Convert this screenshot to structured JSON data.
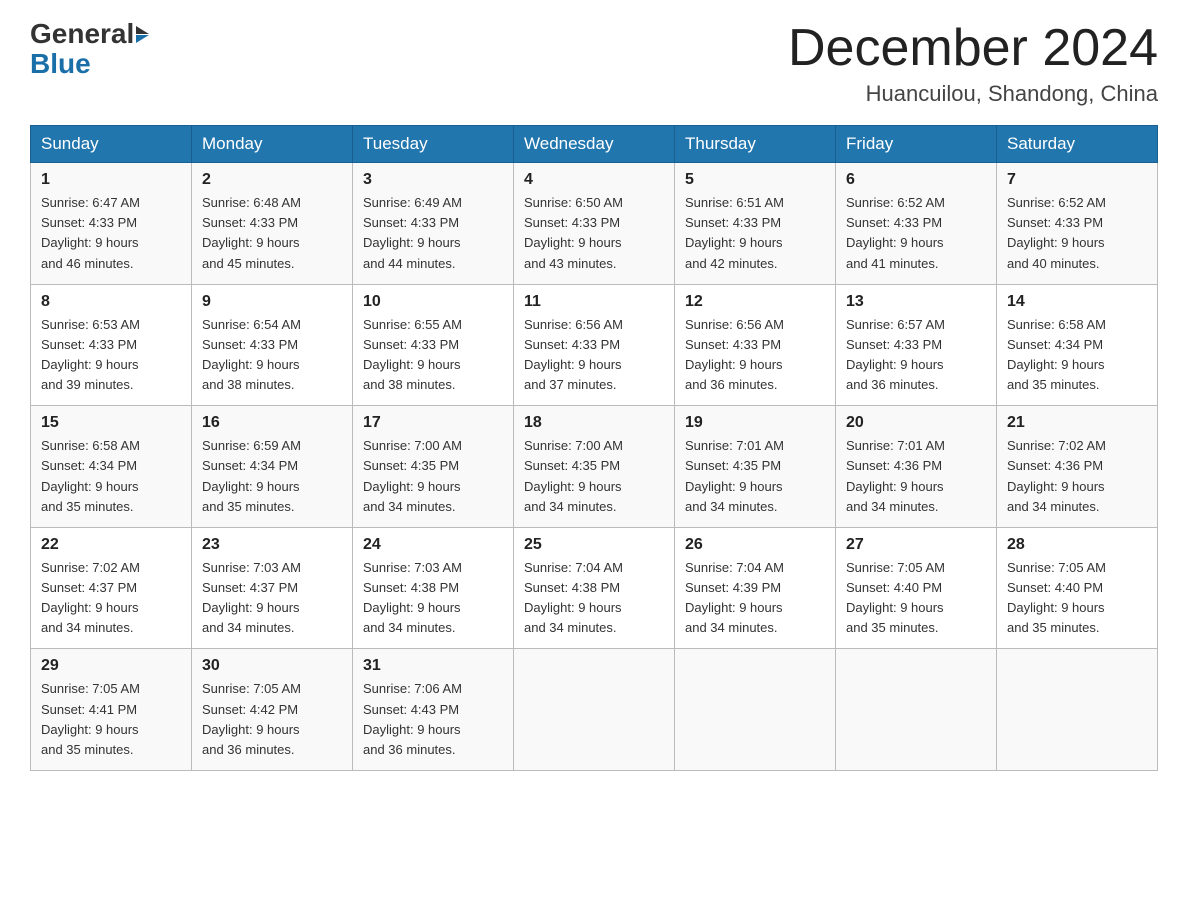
{
  "header": {
    "logo_general": "General",
    "logo_blue": "Blue",
    "month_title": "December 2024",
    "location": "Huancuilou, Shandong, China"
  },
  "days_of_week": [
    "Sunday",
    "Monday",
    "Tuesday",
    "Wednesday",
    "Thursday",
    "Friday",
    "Saturday"
  ],
  "weeks": [
    [
      {
        "day": "1",
        "sunrise": "6:47 AM",
        "sunset": "4:33 PM",
        "daylight": "9 hours and 46 minutes."
      },
      {
        "day": "2",
        "sunrise": "6:48 AM",
        "sunset": "4:33 PM",
        "daylight": "9 hours and 45 minutes."
      },
      {
        "day": "3",
        "sunrise": "6:49 AM",
        "sunset": "4:33 PM",
        "daylight": "9 hours and 44 minutes."
      },
      {
        "day": "4",
        "sunrise": "6:50 AM",
        "sunset": "4:33 PM",
        "daylight": "9 hours and 43 minutes."
      },
      {
        "day": "5",
        "sunrise": "6:51 AM",
        "sunset": "4:33 PM",
        "daylight": "9 hours and 42 minutes."
      },
      {
        "day": "6",
        "sunrise": "6:52 AM",
        "sunset": "4:33 PM",
        "daylight": "9 hours and 41 minutes."
      },
      {
        "day": "7",
        "sunrise": "6:52 AM",
        "sunset": "4:33 PM",
        "daylight": "9 hours and 40 minutes."
      }
    ],
    [
      {
        "day": "8",
        "sunrise": "6:53 AM",
        "sunset": "4:33 PM",
        "daylight": "9 hours and 39 minutes."
      },
      {
        "day": "9",
        "sunrise": "6:54 AM",
        "sunset": "4:33 PM",
        "daylight": "9 hours and 38 minutes."
      },
      {
        "day": "10",
        "sunrise": "6:55 AM",
        "sunset": "4:33 PM",
        "daylight": "9 hours and 38 minutes."
      },
      {
        "day": "11",
        "sunrise": "6:56 AM",
        "sunset": "4:33 PM",
        "daylight": "9 hours and 37 minutes."
      },
      {
        "day": "12",
        "sunrise": "6:56 AM",
        "sunset": "4:33 PM",
        "daylight": "9 hours and 36 minutes."
      },
      {
        "day": "13",
        "sunrise": "6:57 AM",
        "sunset": "4:33 PM",
        "daylight": "9 hours and 36 minutes."
      },
      {
        "day": "14",
        "sunrise": "6:58 AM",
        "sunset": "4:34 PM",
        "daylight": "9 hours and 35 minutes."
      }
    ],
    [
      {
        "day": "15",
        "sunrise": "6:58 AM",
        "sunset": "4:34 PM",
        "daylight": "9 hours and 35 minutes."
      },
      {
        "day": "16",
        "sunrise": "6:59 AM",
        "sunset": "4:34 PM",
        "daylight": "9 hours and 35 minutes."
      },
      {
        "day": "17",
        "sunrise": "7:00 AM",
        "sunset": "4:35 PM",
        "daylight": "9 hours and 34 minutes."
      },
      {
        "day": "18",
        "sunrise": "7:00 AM",
        "sunset": "4:35 PM",
        "daylight": "9 hours and 34 minutes."
      },
      {
        "day": "19",
        "sunrise": "7:01 AM",
        "sunset": "4:35 PM",
        "daylight": "9 hours and 34 minutes."
      },
      {
        "day": "20",
        "sunrise": "7:01 AM",
        "sunset": "4:36 PM",
        "daylight": "9 hours and 34 minutes."
      },
      {
        "day": "21",
        "sunrise": "7:02 AM",
        "sunset": "4:36 PM",
        "daylight": "9 hours and 34 minutes."
      }
    ],
    [
      {
        "day": "22",
        "sunrise": "7:02 AM",
        "sunset": "4:37 PM",
        "daylight": "9 hours and 34 minutes."
      },
      {
        "day": "23",
        "sunrise": "7:03 AM",
        "sunset": "4:37 PM",
        "daylight": "9 hours and 34 minutes."
      },
      {
        "day": "24",
        "sunrise": "7:03 AM",
        "sunset": "4:38 PM",
        "daylight": "9 hours and 34 minutes."
      },
      {
        "day": "25",
        "sunrise": "7:04 AM",
        "sunset": "4:38 PM",
        "daylight": "9 hours and 34 minutes."
      },
      {
        "day": "26",
        "sunrise": "7:04 AM",
        "sunset": "4:39 PM",
        "daylight": "9 hours and 34 minutes."
      },
      {
        "day": "27",
        "sunrise": "7:05 AM",
        "sunset": "4:40 PM",
        "daylight": "9 hours and 35 minutes."
      },
      {
        "day": "28",
        "sunrise": "7:05 AM",
        "sunset": "4:40 PM",
        "daylight": "9 hours and 35 minutes."
      }
    ],
    [
      {
        "day": "29",
        "sunrise": "7:05 AM",
        "sunset": "4:41 PM",
        "daylight": "9 hours and 35 minutes."
      },
      {
        "day": "30",
        "sunrise": "7:05 AM",
        "sunset": "4:42 PM",
        "daylight": "9 hours and 36 minutes."
      },
      {
        "day": "31",
        "sunrise": "7:06 AM",
        "sunset": "4:43 PM",
        "daylight": "9 hours and 36 minutes."
      },
      null,
      null,
      null,
      null
    ]
  ],
  "labels": {
    "sunrise": "Sunrise:",
    "sunset": "Sunset:",
    "daylight": "Daylight:"
  }
}
